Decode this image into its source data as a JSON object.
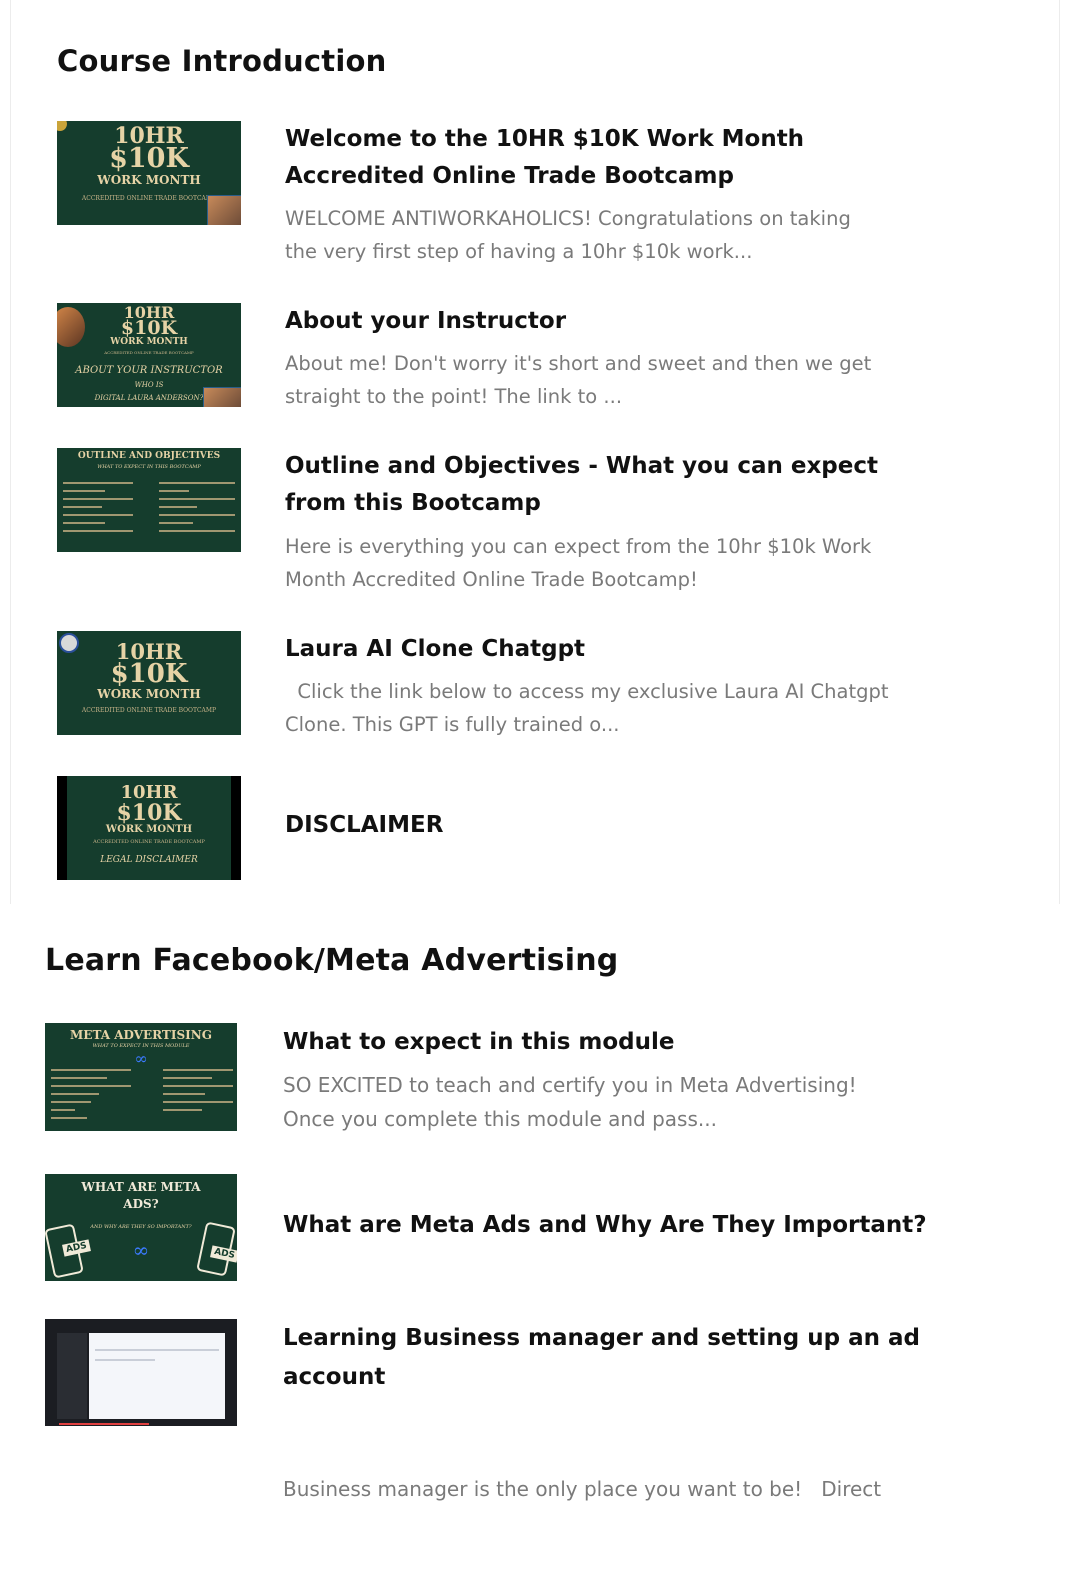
{
  "sections": [
    {
      "title": "Course Introduction",
      "lessons": [
        {
          "title_lines": [
            "Welcome to the 10HR $10K Work Month",
            "Accredited Online Trade Bootcamp"
          ],
          "desc_lines": [
            "WELCOME ANTIWORKAHOLICS! Congratulations on taking",
            "the very first step of having a 10hr $10k work..."
          ],
          "thumb": {
            "l1": "10HR",
            "l2": "$10K",
            "l3": "WORK MONTH",
            "l4": "ACCREDITED ONLINE TRADE BOOTCAMP"
          }
        },
        {
          "title_lines": [
            "About your Instructor"
          ],
          "desc_lines": [
            "About me! Don't worry it's short and sweet and then we get",
            "straight to the point!    The link to ..."
          ],
          "thumb": {
            "l1": "10HR",
            "l2": "$10K",
            "l3": "WORK MONTH",
            "l4": "ACCREDITED ONLINE TRADE BOOTCAMP",
            "l5": "ABOUT YOUR INSTRUCTOR",
            "l6": "WHO IS",
            "l7": "DIGITAL LAURA ANDERSON?"
          }
        },
        {
          "title_lines": [
            "Outline and Objectives - What you can expect",
            "from this Bootcamp"
          ],
          "desc_lines": [
            "Here is everything you can expect from the 10hr $10k Work",
            "Month Accredited Online Trade Bootcamp!"
          ],
          "thumb": {
            "l1": "OUTLINE AND OBJECTIVES",
            "l2": "WHAT TO EXPECT IN THIS BOOTCAMP"
          }
        },
        {
          "title_lines": [
            "Laura AI Clone Chatgpt"
          ],
          "desc_lines": [
            "  Click the link below to access my exclusive Laura AI Chatgpt",
            "Clone. This GPT is fully trained o..."
          ],
          "thumb": {
            "l1": "10HR",
            "l2": "$10K",
            "l3": "WORK MONTH",
            "l4": "ACCREDITED ONLINE TRADE BOOTCAMP"
          }
        },
        {
          "title_lines": [
            "DISCLAIMER"
          ],
          "desc_lines": [],
          "thumb": {
            "l1": "10HR",
            "l2": "$10K",
            "l3": "WORK MONTH",
            "l4": "ACCREDITED ONLINE TRADE BOOTCAMP",
            "l5": "LEGAL DISCLAIMER"
          }
        }
      ]
    },
    {
      "title": "Learn Facebook/Meta Advertising",
      "lessons": [
        {
          "title_lines": [
            "What to expect in this module"
          ],
          "desc_lines": [
            "SO EXCITED to teach and certify you in Meta Advertising!",
            "Once you complete this module and pass..."
          ],
          "thumb": {
            "l1": "META ADVERTISING",
            "l2": "WHAT TO EXPECT IN THIS MODULE"
          }
        },
        {
          "title_lines": [
            "What are Meta Ads and Why Are They Important?"
          ],
          "desc_lines": [],
          "thumb": {
            "l1": "WHAT ARE META",
            "l2": "ADS?",
            "l3": "AND WHY ARE THEY SO IMPORTANT?",
            "l4": "ADS",
            "l5": "ADS"
          }
        },
        {
          "title_lines": [
            "Learning Business manager and setting up an ad",
            "account"
          ],
          "desc_lines": [
            "Business manager is the only place you want to be!   Direct"
          ],
          "thumb": {}
        }
      ]
    }
  ],
  "colors": {
    "thumb_bg": "#153d2d",
    "thumb_text": "#e6d3a6",
    "desc": "#7a7a7a"
  }
}
